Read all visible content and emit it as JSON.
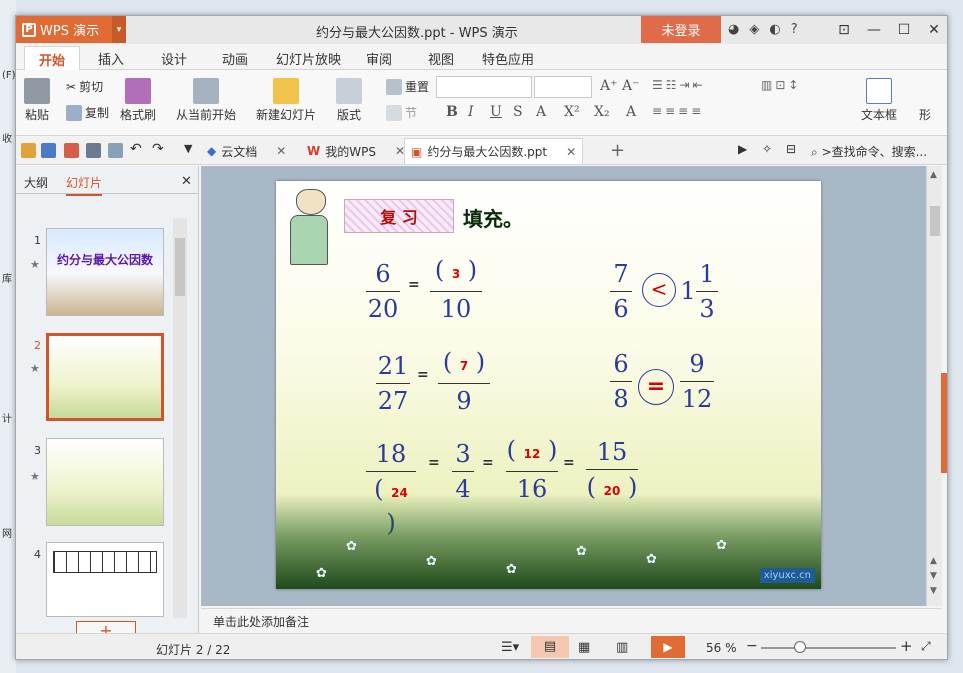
{
  "app": {
    "button_label": "WPS 演示",
    "title": "约分与最大公因数.ppt - WPS 演示",
    "login": "未登录"
  },
  "menu_tabs": [
    "开始",
    "插入",
    "设计",
    "动画",
    "幻灯片放映",
    "审阅",
    "视图",
    "特色应用"
  ],
  "ribbon": {
    "paste": "粘贴",
    "cut": "剪切",
    "copy": "复制",
    "format_painter": "格式刷",
    "from_current": "从当前开始",
    "new_slide": "新建幻灯片",
    "layout": "版式",
    "reset": "重置",
    "section": "节",
    "textbox": "文本框",
    "shape": "形"
  },
  "doc_tabs": [
    {
      "label": "云文档"
    },
    {
      "label": "我的WPS"
    },
    {
      "label": "约分与最大公因数.ppt"
    }
  ],
  "search_placeholder": ">查找命令、搜索...",
  "panel": {
    "outline": "大纲",
    "slides": "幻灯片"
  },
  "thumbnails": [
    {
      "num": "1",
      "title": "约分与最大公因数"
    },
    {
      "num": "2"
    },
    {
      "num": "3"
    },
    {
      "num": "4"
    }
  ],
  "slide": {
    "review_label": "复 习",
    "fill": "填充。",
    "watermark": "xiyuxc.cn",
    "f1": {
      "a_num": "6",
      "a_den": "20",
      "b_num": "3",
      "b_den": "10"
    },
    "f2": {
      "a_num": "21",
      "a_den": "27",
      "b_num": "7",
      "b_den": "9"
    },
    "f3": {
      "a_num": "18",
      "a_den": "24",
      "b_num": "3",
      "b_den": "4",
      "c_num": "12",
      "c_den": "16",
      "d_num": "15",
      "d_den": "20"
    },
    "c1": {
      "l_num": "7",
      "l_den": "6",
      "sign": "<",
      "whole": "1",
      "r_num": "1",
      "r_den": "3"
    },
    "c2": {
      "l_num": "6",
      "l_den": "8",
      "sign": "=",
      "r_num": "9",
      "r_den": "12"
    },
    "eq": "="
  },
  "notes": "单击此处添加备注",
  "status": {
    "slide_counter": "幻灯片 2 / 22",
    "zoom": "56 %",
    "zoom_level": 0.56
  }
}
